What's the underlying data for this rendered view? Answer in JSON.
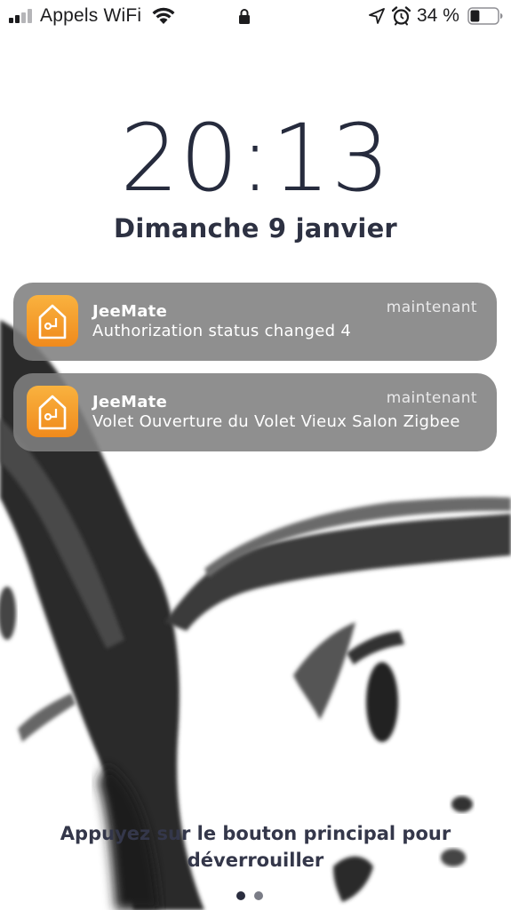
{
  "status_bar": {
    "carrier": "Appels WiFi",
    "battery_percent": "34 %",
    "battery_level": 0.34,
    "icons": [
      "signal-icon",
      "wifi-icon",
      "lock-icon",
      "location-arrow-icon",
      "alarm-icon",
      "battery-icon"
    ]
  },
  "lock_screen": {
    "time": "20:13",
    "date": "Dimanche 9 janvier",
    "unlock_hint": "Appuyez sur le bouton principal pour déverrouiller"
  },
  "notifications": [
    {
      "app": "JeeMate",
      "time": "maintenant",
      "message": "Authorization status changed 4",
      "icon": "jeemate-house-icon"
    },
    {
      "app": "JeeMate",
      "time": "maintenant",
      "message": "Volet Ouverture du Volet Vieux Salon Zigbee",
      "icon": "jeemate-house-icon"
    }
  ],
  "page_indicator": {
    "count": 2,
    "current": 1
  },
  "colors": {
    "text_dark": "#262b3d",
    "notification_bg": "#808080",
    "app_icon_top": "#f9b23f",
    "app_icon_bottom": "#f08a1c"
  }
}
